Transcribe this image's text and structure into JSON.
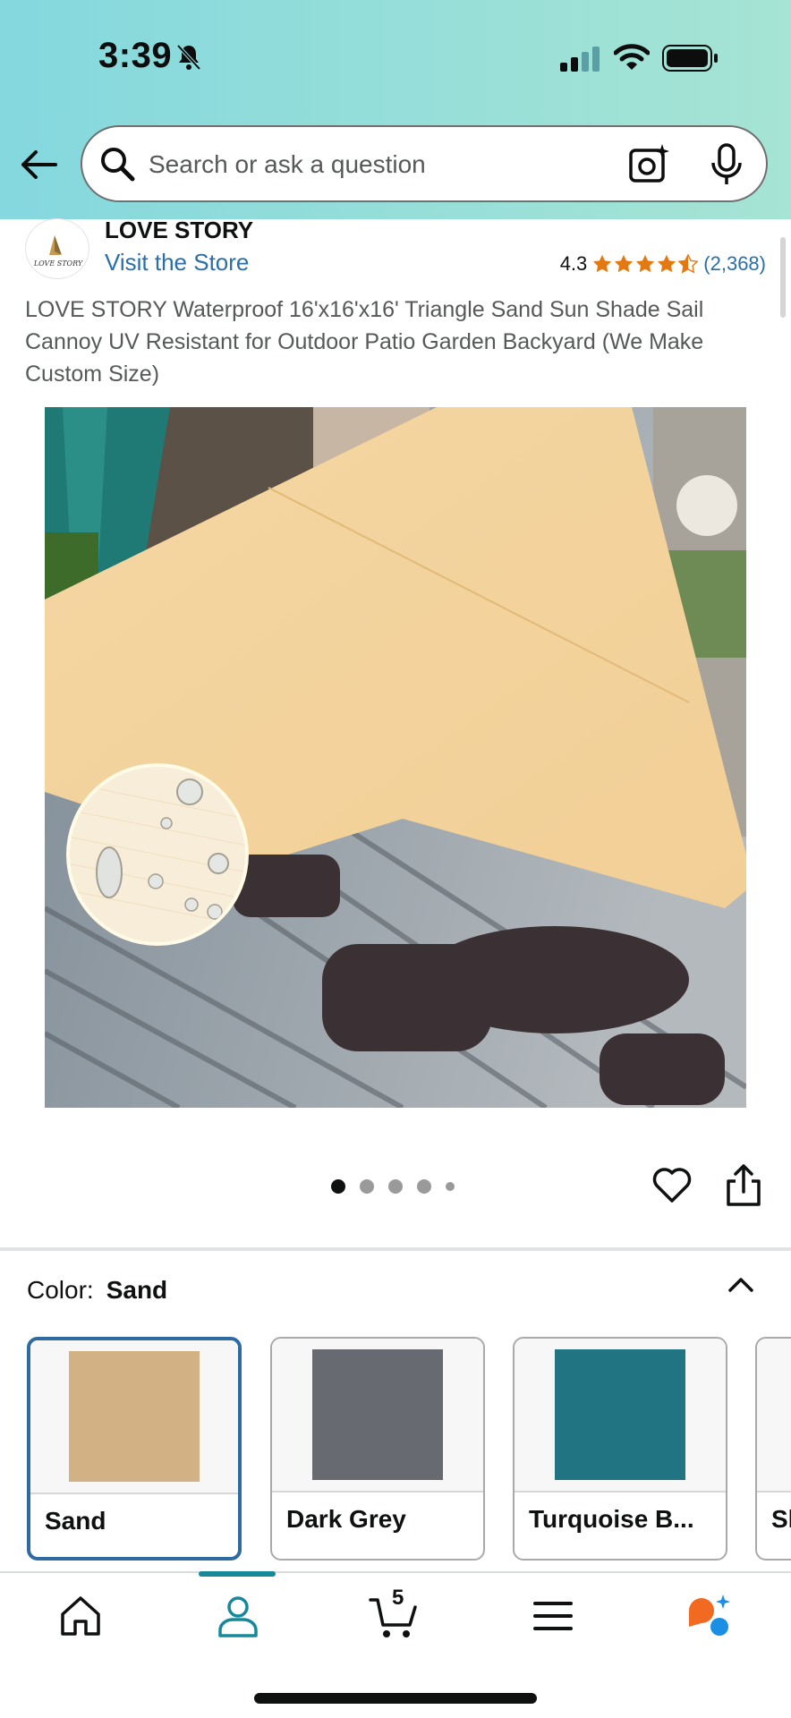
{
  "status_bar": {
    "time": "3:39"
  },
  "search": {
    "placeholder": "Search or ask a question"
  },
  "brand": {
    "name": "LOVE STORY",
    "visit_store": "Visit the Store",
    "logo_text": "LOVE STORY"
  },
  "rating": {
    "value": "4.3",
    "count": "(2,368)",
    "stars": 4.3
  },
  "product": {
    "title": "LOVE STORY Waterproof 16'x16'x16' Triangle Sand Sun Shade Sail Cannoy UV Resistant for Outdoor Patio Garden Backyard (We Make Custom Size)"
  },
  "gallery": {
    "image_count": 5,
    "current_index": 1
  },
  "color": {
    "label": "Color:",
    "selected": "Sand",
    "options": [
      {
        "label": "Sand",
        "color": "#d2b184"
      },
      {
        "label": "Dark Grey",
        "color": "#676a70"
      },
      {
        "label": "Turquoise B...",
        "color": "#217482"
      },
      {
        "label": "Sl",
        "color": "#cccccc"
      }
    ]
  },
  "nav": {
    "cart_count": "5",
    "active_tab": "account"
  },
  "colors": {
    "accent": "#17889a",
    "link": "#2a6fa8",
    "star": "#e47911"
  }
}
